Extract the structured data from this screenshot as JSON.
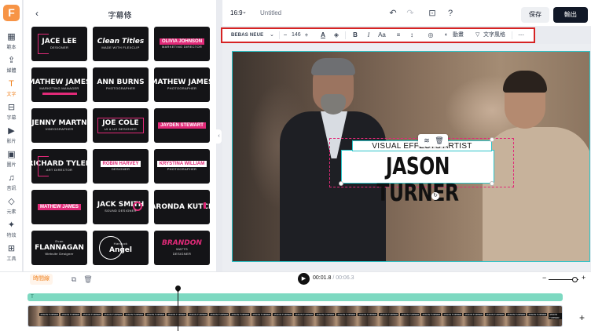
{
  "app": {
    "logo": "F"
  },
  "rail": [
    {
      "id": "template",
      "label": "範本",
      "icon": "▦"
    },
    {
      "id": "upload",
      "label": "媒體",
      "icon": "⇪"
    },
    {
      "id": "text",
      "label": "文字",
      "icon": "T",
      "active": true
    },
    {
      "id": "subtitle",
      "label": "字幕",
      "icon": "⊟"
    },
    {
      "id": "video",
      "label": "影片",
      "icon": "▶"
    },
    {
      "id": "image",
      "label": "圖片",
      "icon": "▣"
    },
    {
      "id": "audio",
      "label": "音訊",
      "icon": "♫"
    },
    {
      "id": "element",
      "label": "元素",
      "icon": "◇"
    },
    {
      "id": "effect",
      "label": "特效",
      "icon": "✦"
    },
    {
      "id": "tools",
      "label": "工具",
      "icon": "⊞"
    }
  ],
  "panel": {
    "title": "字幕條",
    "tiles": [
      {
        "name": "JACE LEE",
        "sub": "DESIGNER"
      },
      {
        "name": "Clean Titles",
        "sub": "MADE WITH FLEXCLIP"
      },
      {
        "name": "OLIVIA JOHNSON",
        "sub": "MARKETING DIRECTOR"
      },
      {
        "name": "MATHEW JAMES",
        "sub": "MARKETING MANAGER"
      },
      {
        "name": "ANN BURNS",
        "sub": "PHOTOGRAPHER"
      },
      {
        "name": "MATHEW JAMES",
        "sub": "PHOTOGRAPHER"
      },
      {
        "name": "JENNY MARTN",
        "sub": "VIDEOGRAPHER"
      },
      {
        "name": "JOE COLE",
        "sub": "UI & UX DESIGNER"
      },
      {
        "name": "JAYDEN STEWART",
        "sub": ""
      },
      {
        "name": "RICHARD TYLER",
        "sub": "ART DIRECTOR"
      },
      {
        "name": "ROBIN HARVEY",
        "sub": "DESIGNER"
      },
      {
        "name": "KRYSTINA WILLIAM",
        "sub": "PHOTOGRAPHER"
      },
      {
        "name": "MATHEW JAMES",
        "sub": ""
      },
      {
        "name": "JACK SMITH",
        "sub": "SOUND DESIGNER"
      },
      {
        "name": "SHARONDA KUTCHER",
        "sub": ""
      },
      {
        "name": "FLANNAGAN",
        "sub": "Evan",
        "sub2": "Website Designer"
      },
      {
        "name": "Angel",
        "sub": "Hancock"
      },
      {
        "name": "BRANDON",
        "sub": "WATTS",
        "sub2": "DESIGNER"
      }
    ]
  },
  "topbar": {
    "ratio": "16:9",
    "doc_name": "Untitled",
    "save": "保存",
    "export": "輸出"
  },
  "format": {
    "font": "BEBAS NEUE",
    "size": "146",
    "effect_label": "動畫",
    "style_label": "文字風格"
  },
  "canvas": {
    "subtitle": "VISUAL EFFECTS ARTIST",
    "title": "JASON TURNER"
  },
  "timeline": {
    "tab": "時間線",
    "current": "00:01.8",
    "total": "/ 00:06.3",
    "clip_label": "JASON TURNER"
  },
  "colors": {
    "accent": "#e12a78",
    "brand": "#f0811e",
    "selection": "#2cc4c9"
  }
}
